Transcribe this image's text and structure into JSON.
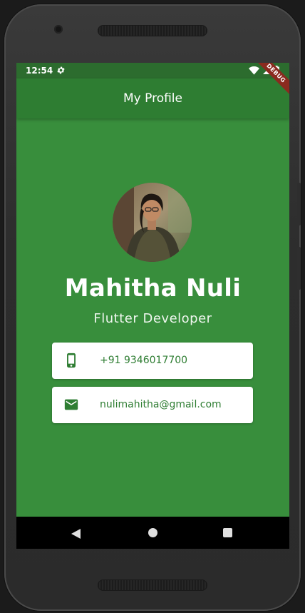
{
  "status_bar": {
    "time": "12:54",
    "settings_icon": "gear-icon",
    "wifi_icon": "wifi-icon",
    "signal_icon": "signal-icon",
    "battery_icon": "battery-icon"
  },
  "debug_banner": "DEBUG",
  "app_bar": {
    "title": "My Profile"
  },
  "profile": {
    "avatar_icon": "profile-photo",
    "name": "Mahitha Nuli",
    "role": "Flutter Developer"
  },
  "contacts": {
    "phone": {
      "icon": "smartphone-icon",
      "value": "+91 9346017700"
    },
    "email": {
      "icon": "email-icon",
      "value": "nulimahitha@gmail.com"
    }
  },
  "nav_bar": {
    "back_icon": "back-triangle-icon",
    "home_icon": "home-circle-icon",
    "recents_icon": "recents-square-icon"
  },
  "colors": {
    "background": "#388e3c",
    "app_bar": "#2e7d32",
    "status_bar": "#2c6c2e",
    "card": "#ffffff",
    "card_text": "#2e7d32"
  }
}
